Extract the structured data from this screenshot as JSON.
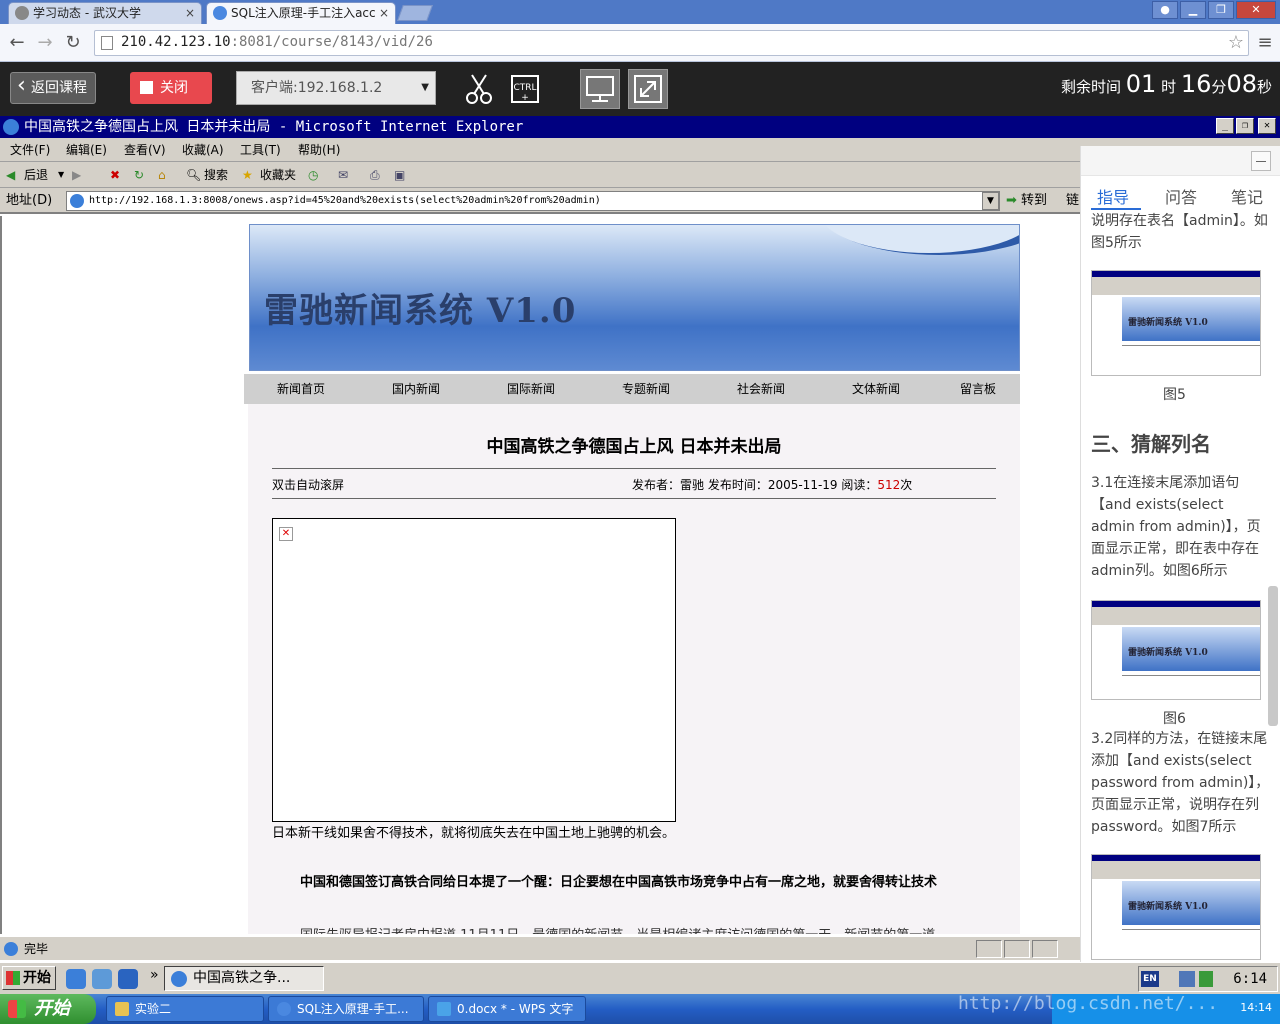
{
  "chrome": {
    "tabs": [
      {
        "label": "学习动态 - 武汉大学"
      },
      {
        "label": "SQL注入原理-手工注入acc"
      }
    ],
    "url_host": "210.42.123.10",
    "url_rest": ":8081/course/8143/vid/26"
  },
  "remote_toolbar": {
    "back_label": "返回课程",
    "close_label": "关闭",
    "client_select": "客户端:192.168.1.2",
    "timer_prefix": "剩余时间",
    "timer_hours": "01",
    "timer_h_unit": "时",
    "timer_minutes": "16",
    "timer_m_unit": "分",
    "timer_seconds": "08",
    "timer_s_unit": "秒"
  },
  "ie": {
    "title": "中国高铁之争德国占上风 日本并未出局 - Microsoft Internet Explorer",
    "menu": [
      "文件(F)",
      "编辑(E)",
      "查看(V)",
      "收藏(A)",
      "工具(T)",
      "帮助(H)"
    ],
    "toolbar": {
      "back": "后退",
      "search": "搜索",
      "favorites": "收藏夹"
    },
    "address_label": "地址(D)",
    "address_value": "http://192.168.1.3:8008/onews.asp?id=45%20and%20exists(select%20admin%20from%20admin)",
    "go_label": "转到",
    "links_label": "链",
    "status_text": "完毕"
  },
  "site": {
    "banner_title": "雷驰新闻系统 V1.0",
    "nav": [
      "新闻首页",
      "国内新闻",
      "国际新闻",
      "专题新闻",
      "社会新闻",
      "文体新闻",
      "留言板"
    ],
    "article_title": "中国高铁之争德国占上风 日本并未出局",
    "meta_left": "双击自动滚屏",
    "meta_right_prefix": "发布者：雷驰 发布时间：2005-11-19 阅读：",
    "read_count": "512",
    "read_suffix": "次",
    "image_caption": "日本新干线如果舍不得技术，就将彻底失去在中国土地上驰骋的机会。",
    "bold_paragraph": "中国和德国签订高铁合同给日本提了一个醒：日企要想在中国高铁市场竞争中占有一席之地，就要舍得转让技术",
    "next_paragraph_partial": "国际先驱导报记者房中报道 11月11日，最德国的新闻节，当是相编诸主席访问德国的第一天，新闻节的第一道"
  },
  "xp_taskbar": {
    "start": "开始",
    "active_item": "中国高铁之争...",
    "lang": "EN",
    "clock": "6:14"
  },
  "win7_taskbar": {
    "start": "开始",
    "items": [
      "实验二",
      "SQL注入原理-手工...",
      "0.docx * - WPS 文字"
    ],
    "clock": "14:14",
    "watermark": "http://blog.csdn.net/..."
  },
  "guide": {
    "tabs": [
      "指导",
      "问答",
      "笔记"
    ],
    "text_top": "说明存在表名【admin】。如图5所示",
    "fig5": "图5",
    "thumb_title": "雷驰新闻系统 V1.0",
    "section_heading": "三、猜解列名",
    "step_3_1": "3.1在连接末尾添加语句【and exists(select admin from admin)】，页面显示正常，即在表中存在admin列。如图6所示",
    "fig6": "图6",
    "step_3_2": "3.2同样的方法，在链接末尾添加【and exists(select password from admin)】，页面显示正常，说明存在列password。如图7所示"
  },
  "colors": {
    "ie_title_bg": "#000080",
    "close_btn": "#e8484e",
    "guide_accent": "#2a6cd6",
    "read_count": "#cc0000"
  }
}
